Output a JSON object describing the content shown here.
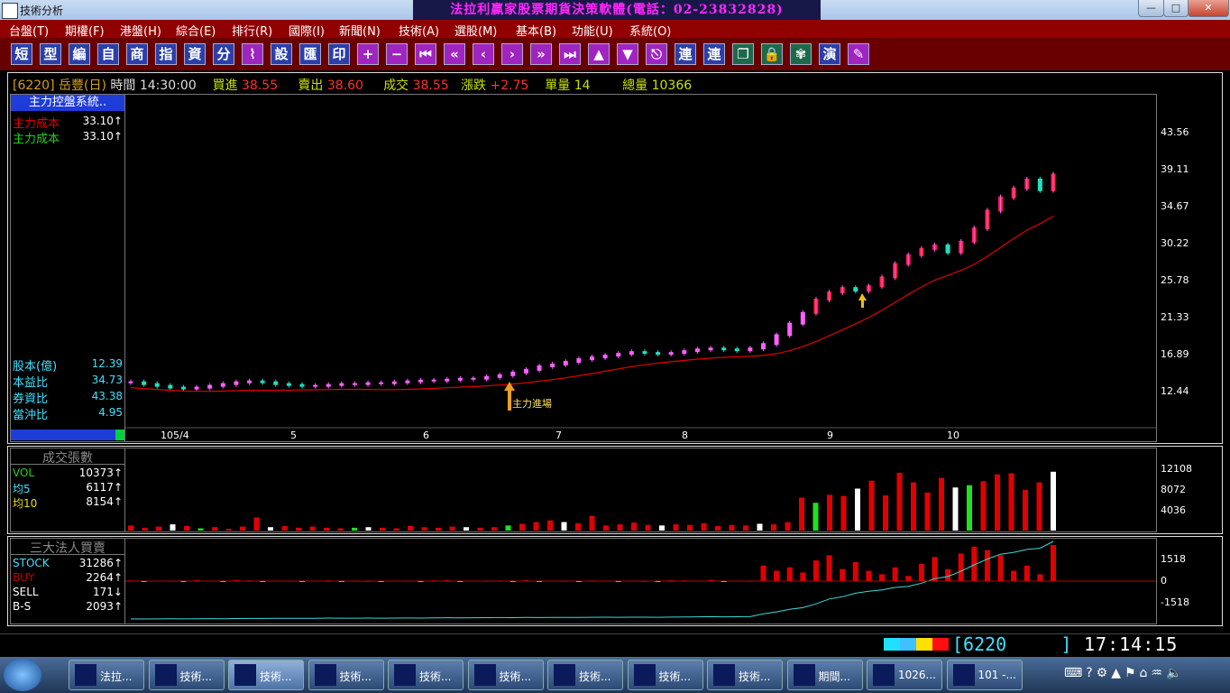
{
  "window": {
    "title": "技術分析",
    "banner": "法拉利贏家股票期貨決策軟體(電話：02-23832828)"
  },
  "window_controls": {
    "minimize": "—",
    "maximize": "□",
    "close": "✕"
  },
  "menu": [
    "台盤(T)",
    "期權(F)",
    "港盤(H)",
    "綜合(E)",
    "排行(R)",
    "國際(I)",
    "新聞(N)",
    "技術(A)",
    "選股(M)",
    "基本(B)",
    "功能(U)",
    "系統(O)"
  ],
  "toolbar": [
    "短",
    "型",
    "編",
    "自",
    "商",
    "指",
    "資",
    "分",
    "line-chart-icon",
    "設",
    "匯",
    "印",
    "plus-icon",
    "minus-icon",
    "first-icon",
    "fast-back-icon",
    "prev-icon",
    "next-icon",
    "fast-forward-icon",
    "last-icon",
    "up-icon",
    "down-icon",
    "esc-icon",
    "連",
    "連",
    "window-icon",
    "lock-icon",
    "fan-icon",
    "演",
    "edit-icon"
  ],
  "quote": {
    "code": "[6220]",
    "name": "岳豐(日)",
    "time_label": "時間",
    "time": "14:30:00",
    "bid_label": "買進",
    "bid": "38.55",
    "ask_label": "賣出",
    "ask": "38.60",
    "last_label": "成交",
    "last": "38.55",
    "change_label": "漲跌",
    "change": "+2.75",
    "vol_label": "單量",
    "vol": "14",
    "total_label": "總量",
    "total": "10366"
  },
  "main_panel": {
    "header": "主力控盤系統..",
    "cost1_label": "主力成本",
    "cost1": "33.10↑",
    "cost2_label": "主力成本",
    "cost2": "33.10↑",
    "stats": [
      {
        "label": "股本(億)",
        "value": "12.39"
      },
      {
        "label": "本益比",
        "value": "34.73"
      },
      {
        "label": "券資比",
        "value": "43.38"
      },
      {
        "label": "當沖比",
        "value": "4.95"
      }
    ],
    "annotation": "主力進場",
    "y_ticks": [
      "43.56",
      "39.11",
      "34.67",
      "30.22",
      "25.78",
      "21.33",
      "16.89",
      "12.44"
    ],
    "x_ticks": [
      "105/4",
      "5",
      "6",
      "7",
      "8",
      "9",
      "10"
    ]
  },
  "volume_panel": {
    "title": "成交張數",
    "rows": [
      {
        "label": "VOL",
        "value": "10373↑"
      },
      {
        "label": "均5",
        "value": "6117↑"
      },
      {
        "label": "均10",
        "value": "8154↑"
      }
    ],
    "y_ticks": [
      "12108",
      "8072",
      "4036"
    ]
  },
  "inst_panel": {
    "title": "三大法人買賣",
    "rows": [
      {
        "label": "STOCK",
        "value": "31286↑"
      },
      {
        "label": "BUY",
        "value": "2264↑"
      },
      {
        "label": "SELL",
        "value": "171↓"
      },
      {
        "label": "B-S",
        "value": "2093↑"
      }
    ],
    "y_ticks": [
      "1518",
      "0",
      "-1518"
    ]
  },
  "status": {
    "code": "[6220     ]",
    "clock": "17:14:15"
  },
  "taskbar": [
    {
      "label": "法拉...",
      "active": false
    },
    {
      "label": "技術...",
      "active": false
    },
    {
      "label": "技術...",
      "active": true
    },
    {
      "label": "技術...",
      "active": false
    },
    {
      "label": "技術...",
      "active": false
    },
    {
      "label": "技術...",
      "active": false
    },
    {
      "label": "技術...",
      "active": false
    },
    {
      "label": "技術...",
      "active": false
    },
    {
      "label": "技術...",
      "active": false
    },
    {
      "label": "期間...",
      "active": false
    },
    {
      "label": "1026...",
      "active": false
    },
    {
      "label": "101 -...",
      "active": false
    }
  ],
  "colors": {
    "up": "#ff2020",
    "down": "#20e0ff",
    "candle_up": "#ff60ff",
    "ma": "#e00000",
    "cyan_line": "#40e0e0"
  },
  "chart_data": {
    "type": "line",
    "price_series": [
      15.2,
      15.0,
      14.8,
      14.6,
      14.5,
      14.6,
      14.8,
      15.0,
      15.2,
      15.3,
      15.2,
      15.0,
      14.9,
      14.8,
      14.8,
      14.9,
      15.0,
      15.0,
      15.1,
      15.1,
      15.2,
      15.3,
      15.4,
      15.4,
      15.5,
      15.6,
      15.6,
      15.8,
      16.0,
      16.3,
      16.6,
      17.0,
      17.2,
      17.5,
      17.8,
      18.0,
      18.2,
      18.4,
      18.6,
      18.5,
      18.4,
      18.5,
      18.7,
      18.9,
      19.0,
      18.9,
      18.8,
      19.0,
      19.5,
      20.5,
      21.8,
      23.0,
      24.5,
      25.3,
      25.8,
      25.5,
      26.0,
      27.0,
      28.5,
      29.5,
      30.2,
      30.6,
      29.8,
      31.0,
      32.5,
      34.5,
      36.0,
      37.0,
      38.0,
      36.8,
      38.55
    ],
    "volume_series": [
      900,
      500,
      700,
      1100,
      800,
      400,
      600,
      300,
      700,
      2300,
      600,
      800,
      500,
      700,
      500,
      400,
      500,
      600,
      500,
      400,
      800,
      600,
      500,
      700,
      600,
      500,
      600,
      900,
      1200,
      1500,
      1800,
      1500,
      1300,
      2600,
      900,
      1100,
      1400,
      1000,
      900,
      1100,
      1000,
      1300,
      800,
      1000,
      900,
      1200,
      1100,
      1500,
      5800,
      4900,
      6300,
      6100,
      7400,
      8800,
      6200,
      10200,
      8500,
      6700,
      9300,
      7600,
      8000,
      8700,
      9900,
      10100,
      7200,
      8500,
      10373
    ],
    "inst_series": [
      40,
      -20,
      30,
      20,
      -10,
      50,
      30,
      -40,
      60,
      40,
      -20,
      30,
      20,
      -10,
      30,
      40,
      -30,
      20,
      10,
      -20,
      30,
      20,
      -10,
      40,
      60,
      -30,
      30,
      20,
      40,
      -30,
      50,
      -20,
      30,
      20,
      -10,
      40,
      30,
      -30,
      20,
      10,
      -20,
      50,
      40,
      30,
      60,
      -50,
      30,
      20,
      900,
      600,
      800,
      500,
      1200,
      1500,
      700,
      1100,
      600,
      400,
      800,
      300,
      1000,
      1400,
      700,
      1600,
      2000,
      1800,
      1500,
      600,
      900,
      400,
      2093
    ],
    "ylim": [
      10.5,
      45.5
    ],
    "xlabel": "",
    "ylabel": ""
  }
}
